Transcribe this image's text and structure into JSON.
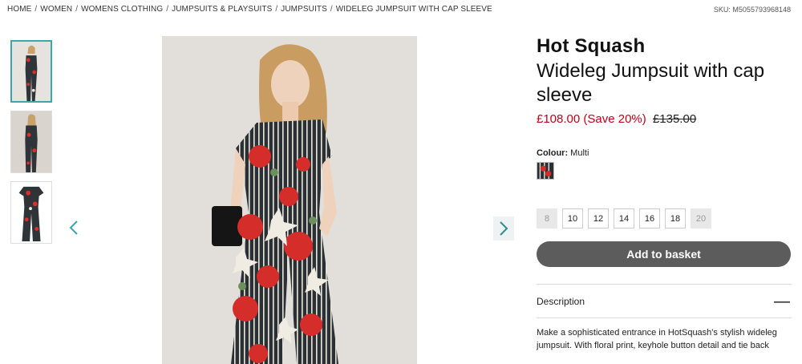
{
  "breadcrumb": [
    "HOME",
    "WOMEN",
    "WOMENS CLOTHING",
    "JUMPSUITS & PLAYSUITS",
    "JUMPSUITS",
    "WIDELEG JUMPSUIT WITH CAP SLEEVE"
  ],
  "breadcrumb_separator": "/",
  "sku": "SKU: M5055793968148",
  "product": {
    "brand": "Hot Squash",
    "title": "Wideleg Jumpsuit with cap sleeve",
    "price_now": "£108.00 (Save 20%)",
    "price_was": "£135.00",
    "colour_label": "Colour:",
    "colour_value": "Multi",
    "sizes": [
      {
        "label": "8",
        "available": false
      },
      {
        "label": "10",
        "available": true
      },
      {
        "label": "12",
        "available": true
      },
      {
        "label": "14",
        "available": true
      },
      {
        "label": "16",
        "available": true
      },
      {
        "label": "18",
        "available": true
      },
      {
        "label": "20",
        "available": false
      }
    ],
    "add_to_basket": "Add to basket",
    "description_label": "Description",
    "description_toggle": "—",
    "description_text": "Make a sophisticated entrance in HotSquash's stylish wideleg jumpsuit. With floral print, keyhole button detail and tie back"
  },
  "icons": {
    "prev": "chevron-left-icon",
    "next": "chevron-right-icon"
  },
  "colors": {
    "accent": "#3aa8a8",
    "sale_price": "#c00018",
    "basket_button": "#5c5c5c"
  }
}
